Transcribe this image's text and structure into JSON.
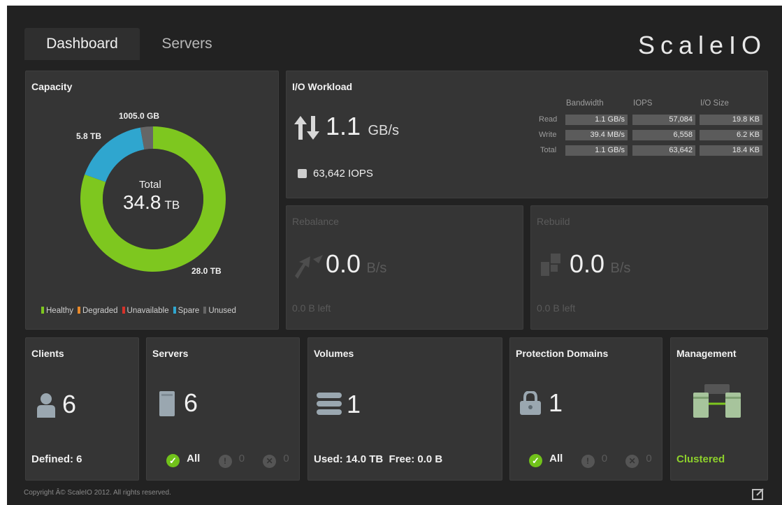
{
  "tabs": {
    "dashboard": "Dashboard",
    "servers": "Servers"
  },
  "logo": "ScaleIO",
  "capacity": {
    "title": "Capacity",
    "total_label": "Total",
    "total_value": "34.8",
    "total_unit": "TB",
    "labels": {
      "unused": "1005.0 GB",
      "spare": "5.8 TB",
      "healthy": "28.0 TB"
    },
    "legend": [
      "Healthy",
      "Degraded",
      "Unavailable",
      "Spare",
      "Unused"
    ],
    "colors": {
      "healthy": "#7ec71f",
      "degraded": "#e8892a",
      "unavailable": "#d6322a",
      "spare": "#2fa6cf",
      "unused": "#666666"
    },
    "fractions": {
      "healthy": 0.805,
      "spare": 0.167,
      "unused": 0.028
    }
  },
  "io": {
    "title": "I/O Workload",
    "bandwidth_value": "1.1",
    "bandwidth_unit": "GB/s",
    "iops_text": "63,642 IOPS",
    "headers": [
      "Bandwidth",
      "IOPS",
      "I/O Size"
    ],
    "rows": [
      {
        "label": "Read",
        "bandwidth": "1.1 GB/s",
        "iops": "57,084",
        "size": "19.8 KB"
      },
      {
        "label": "Write",
        "bandwidth": "39.4 MB/s",
        "iops": "6,558",
        "size": "6.2 KB"
      },
      {
        "label": "Total",
        "bandwidth": "1.1 GB/s",
        "iops": "63,642",
        "size": "18.4 KB"
      }
    ]
  },
  "rebalance": {
    "title": "Rebalance",
    "value": "0.0",
    "unit": "B/s",
    "left": "0.0 B left"
  },
  "rebuild": {
    "title": "Rebuild",
    "value": "0.0",
    "unit": "B/s",
    "left": "0.0 B left"
  },
  "clients": {
    "title": "Clients",
    "count": "6",
    "footer": "Defined: 6"
  },
  "servers": {
    "title": "Servers",
    "count": "6",
    "all": "All",
    "warn": "0",
    "err": "0"
  },
  "volumes": {
    "title": "Volumes",
    "count": "1",
    "footer": "Used: 14.0 TB  Free: 0.0 B"
  },
  "protection": {
    "title": "Protection Domains",
    "count": "1",
    "all": "All",
    "warn": "0",
    "err": "0"
  },
  "management": {
    "title": "Management",
    "status": "Clustered"
  },
  "footer": {
    "copyright": "Copyright Â© ScaleIO 2012. All rights reserved."
  }
}
